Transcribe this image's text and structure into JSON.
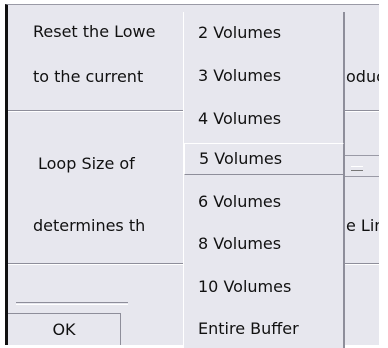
{
  "dialog": {
    "line1": "Reset the Lowe",
    "line2": "to the current",
    "line2_tail": "oduc",
    "loop_label": "Loop Size of",
    "determines_label": "determines th",
    "determines_tail": "e Lin",
    "ok_label": "OK"
  },
  "loop_size_menu": {
    "selected": "5 Volumes",
    "options": [
      "2 Volumes",
      "3 Volumes",
      "4 Volumes",
      "5 Volumes",
      "6 Volumes",
      "8 Volumes",
      "10 Volumes",
      "Entire Buffer"
    ]
  }
}
